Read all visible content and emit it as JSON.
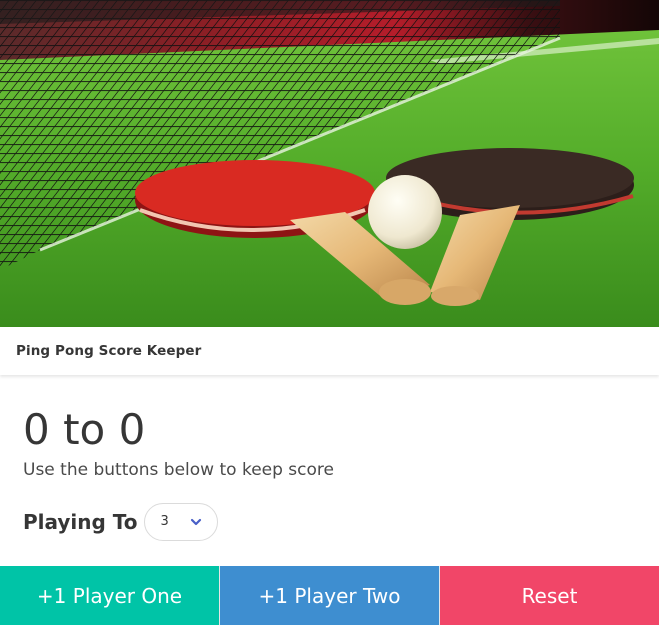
{
  "header": {
    "title": "Ping Pong Score Keeper"
  },
  "hero": {
    "image_description_icon": "ping-pong-paddles-image"
  },
  "score": {
    "text": "0 to 0",
    "player_one": 0,
    "player_two": 0
  },
  "subtitle": "Use the buttons below to keep score",
  "playing_to": {
    "label": "Playing To",
    "selected": "3"
  },
  "buttons": {
    "player_one": "+1 Player One",
    "player_two": "+1 Player Two",
    "reset": "Reset"
  },
  "colors": {
    "player_one": "#00c4a7",
    "player_two": "#3e8ed0",
    "reset": "#f14668",
    "select_arrow": "#485fc7"
  }
}
